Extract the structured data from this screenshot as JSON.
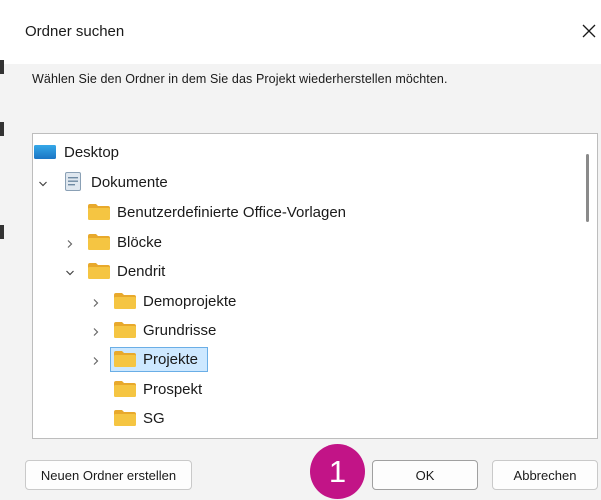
{
  "dialog": {
    "title": "Ordner suchen",
    "instruction": "Wählen Sie den Ordner in dem Sie das Projekt wiederherstellen möchten."
  },
  "tree": {
    "items": [
      {
        "label": "Desktop",
        "icon": "desktop-icon",
        "level": 0,
        "chevron": "none"
      },
      {
        "label": "Dokumente",
        "icon": "documents-icon",
        "level": 0,
        "chevron": "expanded"
      },
      {
        "label": "Benutzerdefinierte Office-Vorlagen",
        "icon": "folder-icon",
        "level": 1,
        "chevron": "none"
      },
      {
        "label": "Blöcke",
        "icon": "folder-icon",
        "level": 1,
        "chevron": "collapsed"
      },
      {
        "label": "Dendrit",
        "icon": "folder-icon",
        "level": 1,
        "chevron": "expanded"
      },
      {
        "label": "Demoprojekte",
        "icon": "folder-icon",
        "level": 2,
        "chevron": "collapsed"
      },
      {
        "label": "Grundrisse",
        "icon": "folder-icon",
        "level": 2,
        "chevron": "collapsed"
      },
      {
        "label": "Projekte",
        "icon": "folder-icon",
        "level": 2,
        "chevron": "collapsed",
        "selected": true
      },
      {
        "label": "Prospekt",
        "icon": "folder-icon",
        "level": 2,
        "chevron": "none"
      },
      {
        "label": "SG",
        "icon": "folder-icon",
        "level": 2,
        "chevron": "none"
      }
    ]
  },
  "buttons": {
    "new_folder": "Neuen Ordner erstellen",
    "ok": "OK",
    "cancel": "Abbrechen"
  },
  "annotation": {
    "step": "1",
    "color": "#c21487"
  },
  "colors": {
    "folder": "#f5c542",
    "selection_bg": "#cde8ff",
    "selection_border": "#6aaee6"
  }
}
